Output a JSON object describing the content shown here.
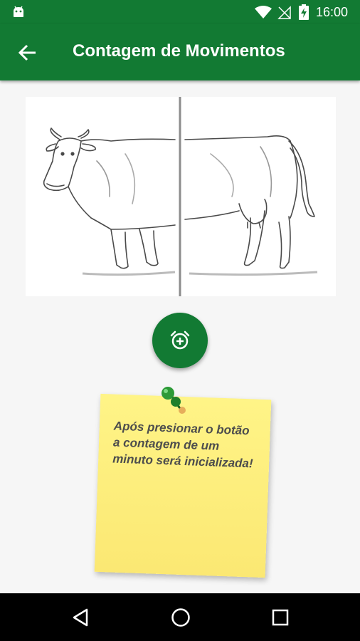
{
  "status_bar": {
    "time": "16:00",
    "icons": [
      "android-icon",
      "wifi-icon",
      "no-signal-icon",
      "battery-charging-icon"
    ]
  },
  "app_bar": {
    "title": "Contagem de Movimentos",
    "back_icon": "arrow-back-icon"
  },
  "main": {
    "image": "cow-front-back-split",
    "fab_icon": "alarm-add-icon"
  },
  "note": {
    "text": "Após presionar o botão a contagem de um minuto será inicializada!",
    "pin_icon": "push-pin-icon"
  },
  "nav_bar": {
    "icons": [
      "back-triangle-icon",
      "home-circle-icon",
      "recents-square-icon"
    ]
  },
  "colors": {
    "primary": "#127a33",
    "note": "#fbe873",
    "background": "#f6f6f6"
  }
}
